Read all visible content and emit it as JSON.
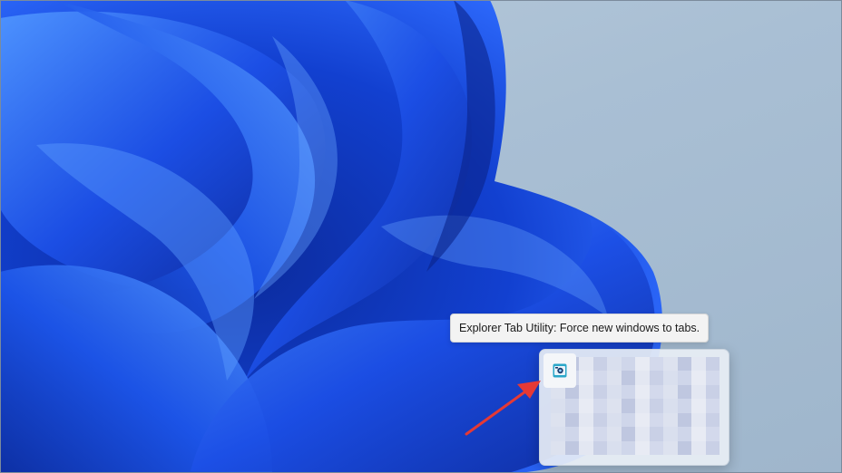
{
  "desktop": {
    "wallpaper": "windows-11-bloom-wallpaper",
    "colors": {
      "background": "#a9bfd4",
      "bloom_dark": "#0a2a9e",
      "bloom_mid": "#1a4fe0",
      "bloom_light": "#3f86ff"
    }
  },
  "tooltip": {
    "text": "Explorer Tab Utility: Force new windows to tabs."
  },
  "tray_overflow": {
    "icon": "explorer-tab-utility-icon",
    "content": "blurred"
  },
  "annotation": {
    "icon": "red-arrow-icon",
    "color": "#e53935"
  }
}
